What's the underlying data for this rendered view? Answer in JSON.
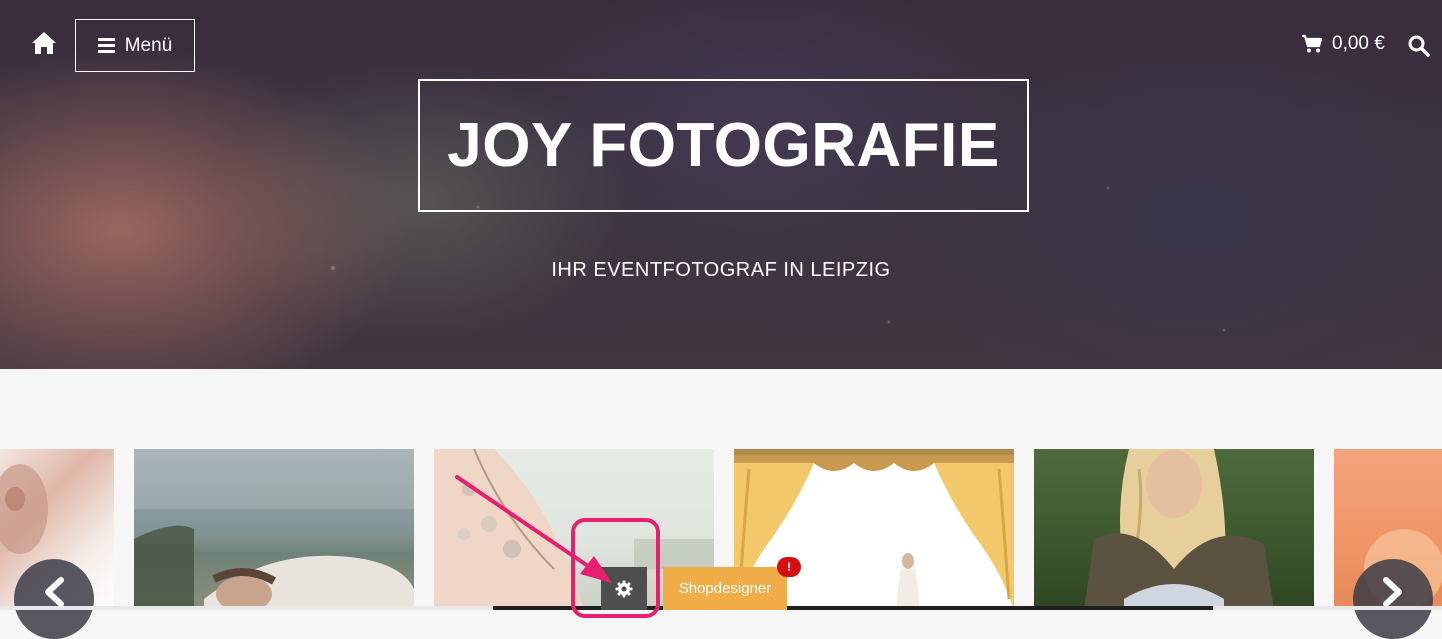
{
  "header": {
    "menu_label": "Menü",
    "cart_total": "0,00 €"
  },
  "hero": {
    "title": "JOY FOTOGRAFIE",
    "subtitle": "IHR EVENTFOTOGRAF IN LEIPZIG"
  },
  "toolbar": {
    "shopdesigner_label": "Shopdesigner",
    "notification_badge": "!"
  },
  "gallery": {
    "items": [
      "portrait-woman",
      "woman-lying-grass",
      "bride-necklace",
      "wedding-curtain",
      "woman-knit-sweater",
      "sunset"
    ]
  },
  "colors": {
    "accent_orange": "#f0ac47",
    "annotation_pink": "#e61f6e",
    "badge_red": "#d40f14"
  }
}
